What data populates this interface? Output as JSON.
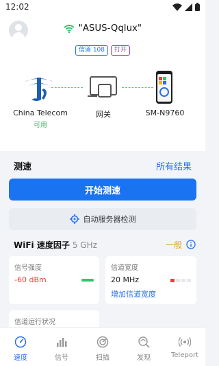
{
  "status_bar": {
    "time": "12:02"
  },
  "header": {
    "ssid": "\"ASUS-Qqlux\"",
    "chips": [
      {
        "label": "信道 108",
        "color": "#2a6ef0"
      },
      {
        "label": "打开",
        "color": "#8a3fd1"
      }
    ]
  },
  "topology": {
    "isp": {
      "name": "China Telecom",
      "status": "可用",
      "status_color": "#34c46a"
    },
    "gateway": {
      "name": "网关",
      "sub": ""
    },
    "device": {
      "name": "SM-N9760"
    }
  },
  "speed_test": {
    "title": "测速",
    "all_results_label": "所有结果",
    "start_label": "开始测速",
    "auto_server_label": "自动服务器检测"
  },
  "wifi_factor": {
    "title": "WiFi 速度因子",
    "band": "5 GHz",
    "rating": "一般"
  },
  "cards": {
    "signal": {
      "key": "信号强度",
      "value": "-60 dBm"
    },
    "width": {
      "key": "信道宽度",
      "value": "20 MHz",
      "action": "增加信道宽度"
    },
    "channel": {
      "key": "信道运行状况"
    }
  },
  "tabs": [
    {
      "label": "速度",
      "icon": "speed-gauge-icon",
      "active": true
    },
    {
      "label": "信号",
      "icon": "signal-bars-icon",
      "active": false
    },
    {
      "label": "扫描",
      "icon": "scan-icon",
      "active": false
    },
    {
      "label": "发现",
      "icon": "discover-icon",
      "active": false
    },
    {
      "label": "Teleport",
      "icon": "teleport-icon",
      "active": false
    }
  ],
  "colors": {
    "accent": "#1a73f0",
    "link": "#2a6ef0",
    "good": "#34c46a",
    "warn": "#e0a21b",
    "bad": "#e8433b"
  }
}
